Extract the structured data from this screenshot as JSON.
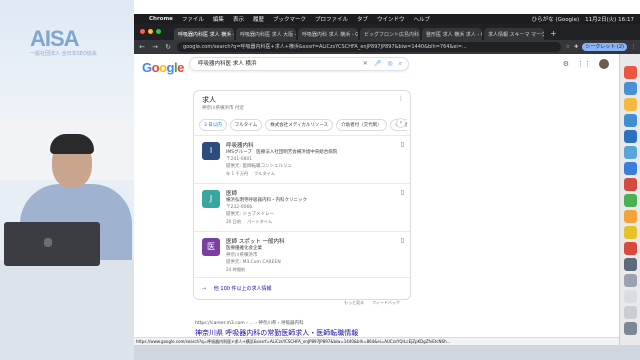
{
  "overlay": {
    "logo_text": "AISA",
    "logo_sub": "一般社団法人 全日本SEO協会"
  },
  "menubar": {
    "apple": "",
    "items": [
      "Chrome",
      "ファイル",
      "編集",
      "表示",
      "履歴",
      "ブックマーク",
      "プロファイル",
      "タブ",
      "ウインドウ",
      "ヘルプ"
    ],
    "user": "ひらがな (Google)",
    "datetime": "11月2日(火) 16:17"
  },
  "tabs": [
    {
      "label": "呼吸器内科医 求人 横浜 - Google 検索",
      "active": true
    },
    {
      "label": "呼吸器内科医 求人 大阪 - Google"
    },
    {
      "label": "呼吸器内科 求人 横浜 - Google"
    },
    {
      "label": "ビッグフロント広島内科 - 呼吸器"
    },
    {
      "label": "整形医 求人 横浜 求人 - Google 検"
    },
    {
      "label": "求人情報 スキーマ マークアップ"
    }
  ],
  "toolbar": {
    "url": "google.com/search?q=呼吸器内科医+求人+横浜&sxsrf=ALiCzsYCSCHFA_enJP897JP897&biw=1440&bih=764&ei=...",
    "profile": "シークレット (2)"
  },
  "search": {
    "query": "呼吸器内科医 求人 横浜"
  },
  "jobs": {
    "title": "求人",
    "subtitle": "神奈川県横浜市 付近",
    "filters": [
      "3 日以内",
      "フルタイム",
      "株式会社メディカルリソース",
      "介助者付（交代制）",
      "その他のフィ"
    ],
    "items": [
      {
        "logo": "I",
        "logo_color": "#2b4c7e",
        "title": "呼吸器内科",
        "company": "IMSグループ　医療法人社団明芳会横浜旭中央総合病院",
        "location": "〒241-0801",
        "via": "提供元: 医師転職コンシェルジュ",
        "meta": [
          "年 1 千万円",
          "フルタイム"
        ]
      },
      {
        "logo": "J",
        "logo_color": "#3aa6a0",
        "title": "医師",
        "company": "横浜弘明寺呼吸器内科・内科クリニック",
        "location": "〒232-0066",
        "via": "提供元: ジョブメドレー",
        "meta": [
          "20 日前",
          "パートタイム"
        ]
      },
      {
        "logo": "医",
        "logo_color": "#7b3fa0",
        "title": "医師 スポット 一般内科",
        "company": "医療優雅化会企業",
        "location": "神奈川県横浜市",
        "via": "提供元: M3.Com CAREEN",
        "meta": [
          "24 時間前"
        ]
      }
    ],
    "more": "他 100 件以上の求人情報"
  },
  "feedback": [
    "もっと見る",
    "フィードバック"
  ],
  "result": {
    "url": "https://career.m3.com › ... › 神奈川県 › 呼吸器内科",
    "title": "神奈川県 呼吸器内科の常勤医師求人・医師転職情報"
  },
  "status_url": "https://www.google.com/search?q=呼吸器内科医+求人+横浜&sxsrf=ALiCzsYCSCHFA_enJP897JP897&biw=1440&bih=864&ei=AUCzsYQrLcEjZpKDgZfvEtcN6h..."
}
